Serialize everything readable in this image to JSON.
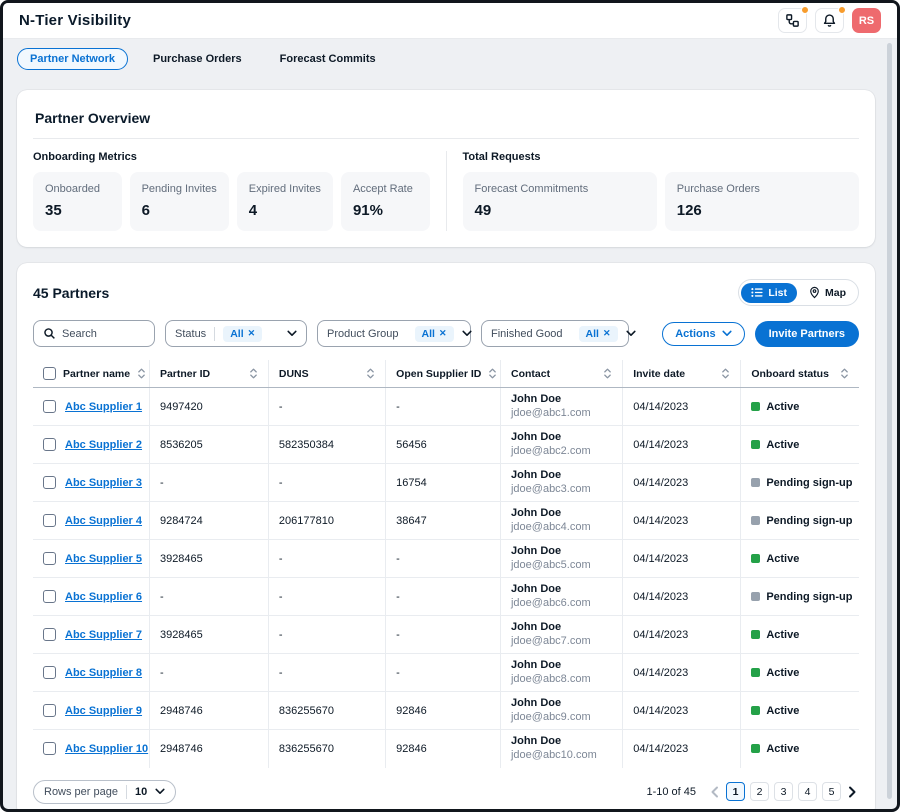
{
  "app": {
    "title": "N-Tier Visibility",
    "avatar_initials": "RS"
  },
  "tabs": [
    {
      "label": "Partner Network",
      "active": true
    },
    {
      "label": "Purchase Orders",
      "active": false
    },
    {
      "label": "Forecast Commits",
      "active": false
    }
  ],
  "overview": {
    "title": "Partner Overview",
    "groups": [
      {
        "label": "Onboarding Metrics",
        "metrics": [
          {
            "label": "Onboarded",
            "value": "35"
          },
          {
            "label": "Pending Invites",
            "value": "6"
          },
          {
            "label": "Expired Invites",
            "value": "4"
          },
          {
            "label": "Accept Rate",
            "value": "91%"
          }
        ]
      },
      {
        "label": "Total Requests",
        "metrics": [
          {
            "label": "Forecast Commitments",
            "value": "49"
          },
          {
            "label": "Purchase Orders",
            "value": "126"
          }
        ]
      }
    ]
  },
  "partners": {
    "title": "45 Partners",
    "view_toggle": {
      "list": "List",
      "map": "Map",
      "selected": "List"
    },
    "search": {
      "placeholder": "Search"
    },
    "filters": [
      {
        "label": "Status",
        "value": "All"
      },
      {
        "label": "Product Group",
        "value": "All"
      },
      {
        "label": "Finished Good",
        "value": "All"
      }
    ],
    "actions_label": "Actions",
    "invite_label": "Invite Partners",
    "table": {
      "columns": [
        "Partner name",
        "Partner ID",
        "DUNS",
        "Open Supplier ID",
        "Contact",
        "Invite date",
        "Onboard status"
      ],
      "rows": [
        {
          "name": "Abc Supplier 1",
          "partner_id": "9497420",
          "duns": "-",
          "open_supplier_id": "-",
          "contact_name": "John Doe",
          "contact_email": "jdoe@abc1.com",
          "invite_date": "04/14/2023",
          "status": "Active"
        },
        {
          "name": "Abc Supplier 2",
          "partner_id": "8536205",
          "duns": "582350384",
          "open_supplier_id": "56456",
          "contact_name": "John Doe",
          "contact_email": "jdoe@abc2.com",
          "invite_date": "04/14/2023",
          "status": "Active"
        },
        {
          "name": "Abc Supplier 3",
          "partner_id": "-",
          "duns": "-",
          "open_supplier_id": "16754",
          "contact_name": "John Doe",
          "contact_email": "jdoe@abc3.com",
          "invite_date": "04/14/2023",
          "status": "Pending sign-up"
        },
        {
          "name": "Abc Supplier 4",
          "partner_id": "9284724",
          "duns": "206177810",
          "open_supplier_id": "38647",
          "contact_name": "John Doe",
          "contact_email": "jdoe@abc4.com",
          "invite_date": "04/14/2023",
          "status": "Pending sign-up"
        },
        {
          "name": "Abc Supplier 5",
          "partner_id": "3928465",
          "duns": "-",
          "open_supplier_id": "-",
          "contact_name": "John Doe",
          "contact_email": "jdoe@abc5.com",
          "invite_date": "04/14/2023",
          "status": "Active"
        },
        {
          "name": "Abc Supplier 6",
          "partner_id": "-",
          "duns": "-",
          "open_supplier_id": "-",
          "contact_name": "John Doe",
          "contact_email": "jdoe@abc6.com",
          "invite_date": "04/14/2023",
          "status": "Pending sign-up"
        },
        {
          "name": "Abc Supplier 7",
          "partner_id": "3928465",
          "duns": "-",
          "open_supplier_id": "-",
          "contact_name": "John Doe",
          "contact_email": "jdoe@abc7.com",
          "invite_date": "04/14/2023",
          "status": "Active"
        },
        {
          "name": "Abc Supplier 8",
          "partner_id": "-",
          "duns": "-",
          "open_supplier_id": "-",
          "contact_name": "John Doe",
          "contact_email": "jdoe@abc8.com",
          "invite_date": "04/14/2023",
          "status": "Active"
        },
        {
          "name": "Abc Supplier 9",
          "partner_id": "2948746",
          "duns": "836255670",
          "open_supplier_id": "92846",
          "contact_name": "John Doe",
          "contact_email": "jdoe@abc9.com",
          "invite_date": "04/14/2023",
          "status": "Active"
        },
        {
          "name": "Abc Supplier 10",
          "partner_id": "2948746",
          "duns": "836255670",
          "open_supplier_id": "92846",
          "contact_name": "John Doe",
          "contact_email": "jdoe@abc10.com",
          "invite_date": "04/14/2023",
          "status": "Active"
        }
      ]
    },
    "pagination": {
      "rows_per_page_label": "Rows per page",
      "rows_per_page_value": "10",
      "range": "1-10 of 45",
      "pages": [
        "1",
        "2",
        "3",
        "4",
        "5"
      ],
      "current_page": "1"
    }
  },
  "colors": {
    "accent_blue": "#0972d3",
    "status_active_green": "#24a148",
    "status_pending_gray": "#97a1ad",
    "avatar_red": "#ee6a6e",
    "notification_orange": "#f79c2d"
  }
}
